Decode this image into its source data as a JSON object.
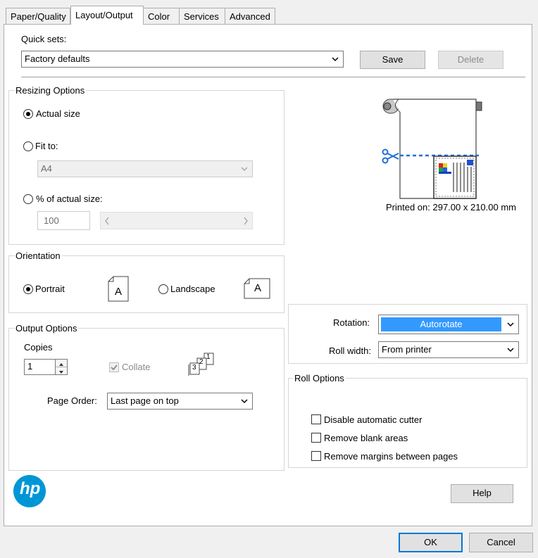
{
  "tabs": [
    {
      "label": "Paper/Quality"
    },
    {
      "label": "Layout/Output"
    },
    {
      "label": "Color"
    },
    {
      "label": "Services"
    },
    {
      "label": "Advanced"
    }
  ],
  "active_tab": "Layout/Output",
  "quick_sets": {
    "label": "Quick sets:",
    "value": "Factory defaults",
    "save_label": "Save",
    "delete_label": "Delete"
  },
  "resizing": {
    "title": "Resizing Options",
    "actual_size_label": "Actual size",
    "fit_to_label": "Fit to:",
    "fit_to_value": "A4",
    "percent_label": "% of actual size:",
    "percent_value": "100",
    "selected": "Actual size"
  },
  "preview": {
    "printed_on": "Printed on: 297.00 x 210.00 mm"
  },
  "orientation": {
    "title": "Orientation",
    "portrait_label": "Portrait",
    "landscape_label": "Landscape",
    "selected": "Portrait",
    "icon_letter": "A"
  },
  "output": {
    "title": "Output Options",
    "copies_label": "Copies",
    "copies_value": "1",
    "collate_label": "Collate",
    "collate_checked": true,
    "page_order_label": "Page Order:",
    "page_order_value": "Last page on top",
    "stack_numbers": [
      "3",
      "2",
      "1"
    ]
  },
  "rotation": {
    "label": "Rotation:",
    "value": "Autorotate",
    "roll_width_label": "Roll width:",
    "roll_width_value": "From printer"
  },
  "roll_options": {
    "title": "Roll Options",
    "items": [
      {
        "label": "Disable automatic cutter",
        "checked": false
      },
      {
        "label": "Remove blank areas",
        "checked": false
      },
      {
        "label": "Remove margins between pages",
        "checked": false
      }
    ]
  },
  "logo_text": "hp",
  "help_label": "Help",
  "ok_label": "OK",
  "cancel_label": "Cancel",
  "colors": {
    "accent": "#3399ff",
    "hp_blue": "#0096d6",
    "cut_line": "#1e6fd9"
  },
  "icons": [
    "chevron-down-icon",
    "chevron-left-icon",
    "chevron-right-icon",
    "scissors-icon",
    "spinner-up-icon",
    "spinner-down-icon",
    "portrait-page-icon",
    "landscape-page-icon",
    "page-stack-icon",
    "hp-logo"
  ]
}
